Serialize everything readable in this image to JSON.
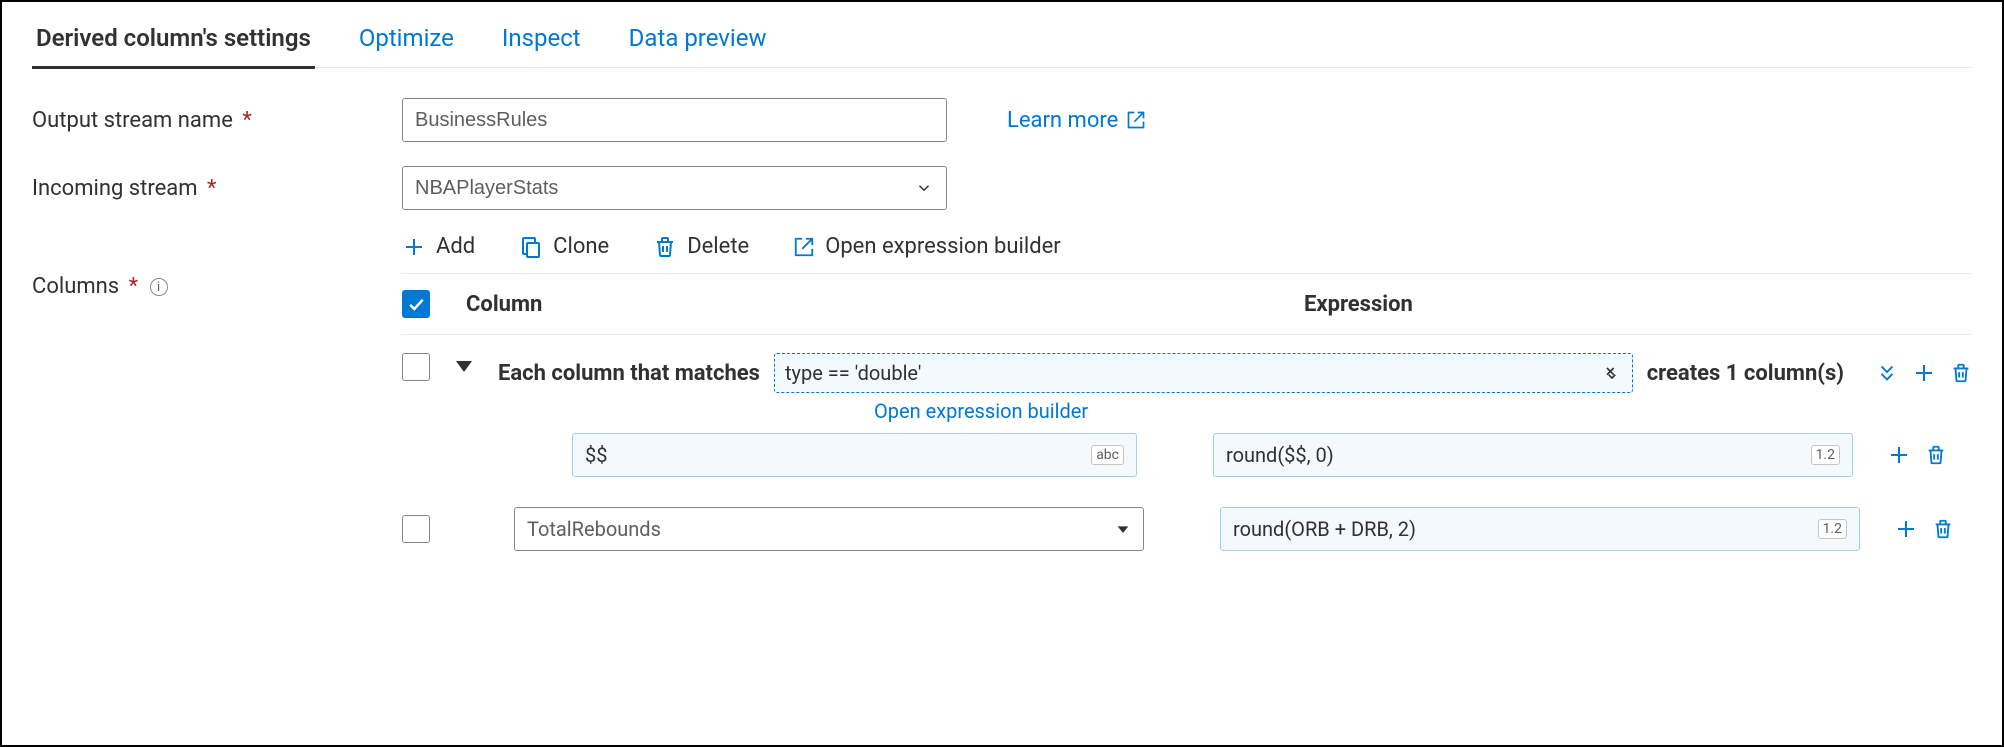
{
  "tabs": {
    "settings": "Derived column's settings",
    "optimize": "Optimize",
    "inspect": "Inspect",
    "preview": "Data preview"
  },
  "form": {
    "outputStreamLabel": "Output stream name",
    "outputStreamValue": "BusinessRules",
    "incomingStreamLabel": "Incoming stream",
    "incomingStreamValue": "NBAPlayerStats",
    "columnsLabel": "Columns",
    "learnMore": "Learn more"
  },
  "toolbar": {
    "add": "Add",
    "clone": "Clone",
    "delete": "Delete",
    "openBuilder": "Open expression builder"
  },
  "grid": {
    "headerColumn": "Column",
    "headerExpression": "Expression",
    "pattern": {
      "prefix": "Each column that matches",
      "condition": "type == 'double'",
      "suffix": "creates 1 column(s)",
      "openBuilder": "Open expression builder",
      "nameExpr": "$$",
      "nameBadge": "abc",
      "valueExpr": "round($$, 0)",
      "valueBadge": "1.2"
    },
    "row2": {
      "column": "TotalRebounds",
      "expr": "round(ORB + DRB, 2)",
      "badge": "1.2"
    }
  }
}
